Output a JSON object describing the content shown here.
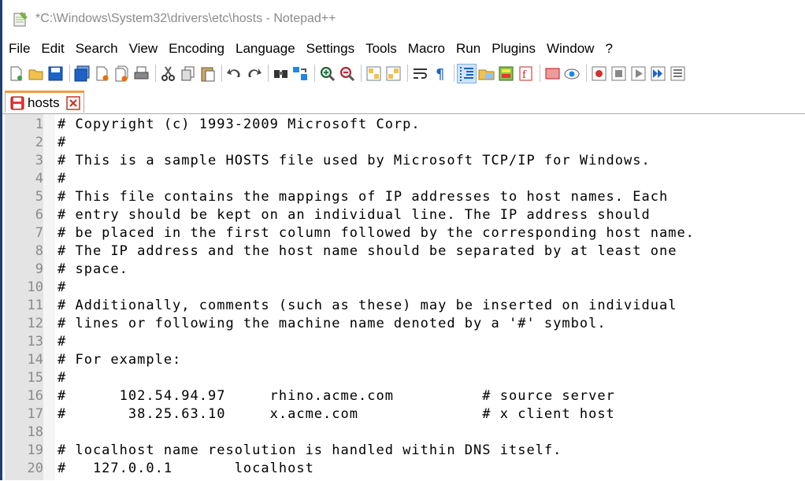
{
  "window": {
    "title": "*C:\\Windows\\System32\\drivers\\etc\\hosts - Notepad++"
  },
  "menu": [
    "File",
    "Edit",
    "Search",
    "View",
    "Encoding",
    "Language",
    "Settings",
    "Tools",
    "Macro",
    "Run",
    "Plugins",
    "Window",
    "?"
  ],
  "toolbar": {
    "icons": [
      "new-file-icon",
      "open-file-icon",
      "save-icon",
      "save-all-icon",
      "close-icon",
      "close-all-icon",
      "print-icon",
      "cut-icon",
      "copy-icon",
      "paste-icon",
      "undo-icon",
      "redo-icon",
      "find-icon",
      "replace-icon",
      "zoom-in-icon",
      "zoom-out-icon",
      "sync-vertical-icon",
      "sync-horizontal-icon",
      "word-wrap-icon",
      "show-all-chars-icon",
      "indent-guide-icon",
      "folder-workspace-icon",
      "document-map-icon",
      "function-list-icon",
      "folder-as-workspace-icon",
      "monitoring-icon",
      "record-macro-icon",
      "stop-record-icon",
      "play-macro-icon",
      "run-macro-multiple-icon",
      "save-macro-icon"
    ],
    "active_icon": "indent-guide-icon"
  },
  "tabs": [
    {
      "label": "hosts",
      "modified": true
    }
  ],
  "editor": {
    "lines": [
      {
        "n": "1",
        "text": "# Copyright (c) 1993-2009 Microsoft Corp."
      },
      {
        "n": "2",
        "text": "#"
      },
      {
        "n": "3",
        "text": "# This is a sample HOSTS file used by Microsoft TCP/IP for Windows."
      },
      {
        "n": "4",
        "text": "#"
      },
      {
        "n": "5",
        "text": "# This file contains the mappings of IP addresses to host names. Each"
      },
      {
        "n": "6",
        "text": "# entry should be kept on an individual line. The IP address should"
      },
      {
        "n": "7",
        "text": "# be placed in the first column followed by the corresponding host name."
      },
      {
        "n": "8",
        "text": "# The IP address and the host name should be separated by at least one"
      },
      {
        "n": "9",
        "text": "# space."
      },
      {
        "n": "10",
        "text": "#"
      },
      {
        "n": "11",
        "text": "# Additionally, comments (such as these) may be inserted on individual"
      },
      {
        "n": "12",
        "text": "# lines or following the machine name denoted by a '#' symbol."
      },
      {
        "n": "13",
        "text": "#"
      },
      {
        "n": "14",
        "text": "# For example:"
      },
      {
        "n": "15",
        "text": "#"
      },
      {
        "n": "16",
        "text": "#      102.54.94.97     rhino.acme.com          # source server"
      },
      {
        "n": "17",
        "text": "#       38.25.63.10     x.acme.com              # x client host"
      },
      {
        "n": "18",
        "text": ""
      },
      {
        "n": "19",
        "text": "# localhost name resolution is handled within DNS itself."
      },
      {
        "n": "20",
        "text": "#   127.0.0.1       localhost"
      }
    ]
  }
}
